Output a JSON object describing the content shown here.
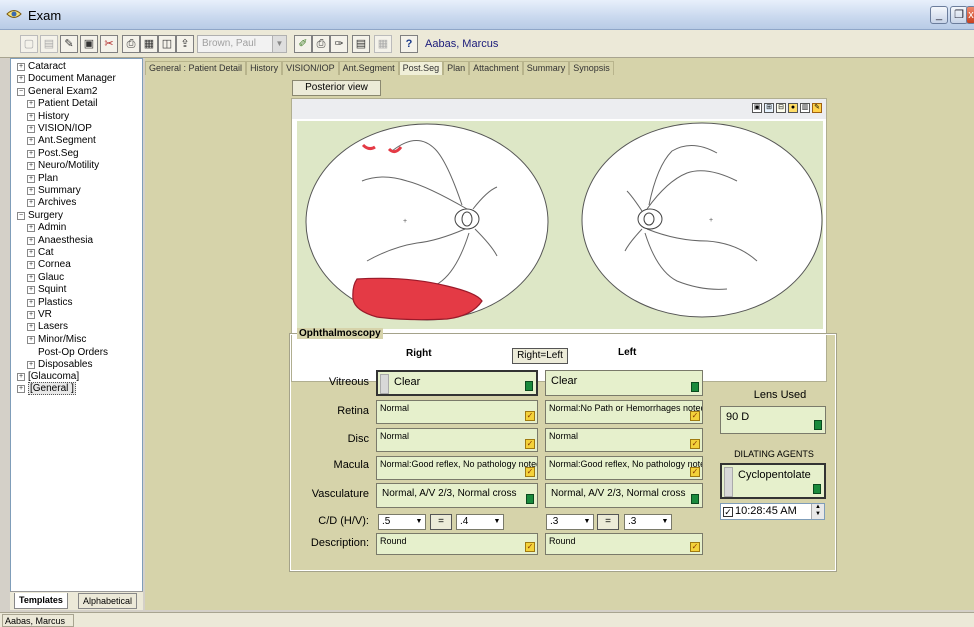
{
  "window": {
    "title": "Exam"
  },
  "toolbar": {
    "patient": "Brown, Paul",
    "user": "Aabas, Marcus"
  },
  "tree": {
    "items": [
      {
        "label": "Cataract",
        "pm": "+",
        "indent": 0
      },
      {
        "label": "Document Manager",
        "pm": "+",
        "indent": 0
      },
      {
        "label": "General Exam2",
        "pm": "−",
        "indent": 0
      },
      {
        "label": "Patient Detail",
        "pm": "+",
        "indent": 1
      },
      {
        "label": "History",
        "pm": "+",
        "indent": 1
      },
      {
        "label": "VISION/IOP",
        "pm": "+",
        "indent": 1
      },
      {
        "label": "Ant.Segment",
        "pm": "+",
        "indent": 1
      },
      {
        "label": "Post.Seg",
        "pm": "+",
        "indent": 1
      },
      {
        "label": "Neuro/Motility",
        "pm": "+",
        "indent": 1
      },
      {
        "label": "Plan",
        "pm": "+",
        "indent": 1
      },
      {
        "label": "Summary",
        "pm": "+",
        "indent": 1
      },
      {
        "label": "Archives",
        "pm": "+",
        "indent": 1
      },
      {
        "label": "Surgery",
        "pm": "−",
        "indent": 0
      },
      {
        "label": "Admin",
        "pm": "+",
        "indent": 1
      },
      {
        "label": "Anaesthesia",
        "pm": "+",
        "indent": 1
      },
      {
        "label": "Cat",
        "pm": "+",
        "indent": 1
      },
      {
        "label": "Cornea",
        "pm": "+",
        "indent": 1
      },
      {
        "label": "Glauc",
        "pm": "+",
        "indent": 1
      },
      {
        "label": "Squint",
        "pm": "+",
        "indent": 1
      },
      {
        "label": "Plastics",
        "pm": "+",
        "indent": 1
      },
      {
        "label": "VR",
        "pm": "+",
        "indent": 1
      },
      {
        "label": "Lasers",
        "pm": "+",
        "indent": 1
      },
      {
        "label": "Minor/Misc",
        "pm": "+",
        "indent": 1
      },
      {
        "label": "Post-Op Orders",
        "pm": "",
        "indent": 1
      },
      {
        "label": "Disposables",
        "pm": "+",
        "indent": 1
      },
      {
        "label": "[Glaucoma]",
        "pm": "+",
        "indent": 0
      },
      {
        "label": "[General ]",
        "pm": "+",
        "indent": 0,
        "selected": true
      }
    ],
    "tabs": {
      "templates": "Templates",
      "alphabetical": "Alphabetical"
    }
  },
  "tabs": [
    "General : Patient Detail",
    "History",
    "VISION/IOP",
    "Ant.Segment",
    "Post.Seg",
    "Plan",
    "Attachment",
    "Summary",
    "Synopsis"
  ],
  "active_tab": "Post.Seg",
  "posterior_view_button": "Posterior view",
  "ophthalmoscopy": {
    "title": "Ophthalmoscopy",
    "right_head": "Right",
    "left_head": "Left",
    "right_eq_left": "Right=Left",
    "labels": {
      "vitreous": "Vitreous",
      "retina": "Retina",
      "disc": "Disc",
      "macula": "Macula",
      "vasculature": "Vasculature",
      "cd": "C/D (H/V):",
      "description": "Description:"
    },
    "right": {
      "vitreous": "Clear",
      "retina": "Normal",
      "disc": "Normal",
      "macula": "Normal:Good reflex, No pathology noted",
      "vasculature": "Normal,  A/V 2/3, Normal cross",
      "cd_h": ".5",
      "cd_v": ".4",
      "description": "Round"
    },
    "left": {
      "vitreous": "Clear",
      "retina": "Normal:No Path or Hemorrhages noted",
      "disc": "Normal",
      "macula": "Normal:Good reflex, No pathology noted",
      "vasculature": "Normal,  A/V 2/3, Normal cross",
      "cd_h": ".3",
      "cd_v": ".3",
      "description": "Round"
    },
    "eq_label": "="
  },
  "side": {
    "lens_used_label": "Lens Used",
    "lens_used_value": "90 D",
    "dilating_label": "DILATING AGENTS",
    "dilating_value": "Cyclopentolate",
    "time": "10:28:45 AM"
  },
  "status": {
    "user": "Aabas, Marcus"
  },
  "colors": {
    "field_bg": "#e6f0cc",
    "panel_bg": "#d6d3aa",
    "lesion_red": "#e43a45",
    "fundus_bg": "#dde7c6"
  }
}
